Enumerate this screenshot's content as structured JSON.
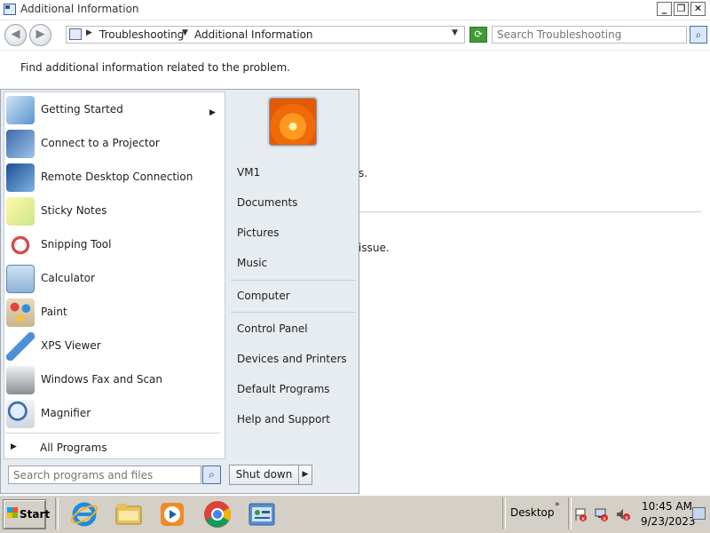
{
  "window": {
    "title": "Additional Information",
    "minimize": "_",
    "restore": "❐",
    "close": "✕"
  },
  "address_bar": {
    "breadcrumb": [
      "Troubleshooting",
      "Additional Information"
    ],
    "search_placeholder": "Search Troubleshooting"
  },
  "content": {
    "description": "Find additional information related to the problem.",
    "partial_line_1": "s.",
    "partial_line_2": "issue."
  },
  "start_menu": {
    "programs": [
      {
        "label": "Getting Started",
        "icon": "getting-started-icon",
        "has_submenu": true
      },
      {
        "label": "Connect to a Projector",
        "icon": "projector-icon"
      },
      {
        "label": "Remote Desktop Connection",
        "icon": "remote-desktop-icon"
      },
      {
        "label": "Sticky Notes",
        "icon": "sticky-notes-icon"
      },
      {
        "label": "Snipping Tool",
        "icon": "scissors-icon"
      },
      {
        "label": "Calculator",
        "icon": "calculator-icon"
      },
      {
        "label": "Paint",
        "icon": "paint-palette-icon"
      },
      {
        "label": "XPS Viewer",
        "icon": "paper-plane-icon"
      },
      {
        "label": "Windows Fax and Scan",
        "icon": "fax-icon"
      },
      {
        "label": "Magnifier",
        "icon": "magnifier-icon"
      }
    ],
    "all_programs": "All Programs",
    "search_placeholder": "Search programs and files",
    "right_links": {
      "user": "VM1",
      "documents": "Documents",
      "pictures": "Pictures",
      "music": "Music",
      "computer": "Computer",
      "control_panel": "Control Panel",
      "devices_printers": "Devices and Printers",
      "default_programs": "Default Programs",
      "help_support": "Help and Support"
    },
    "shutdown": "Shut down"
  },
  "taskbar": {
    "start": "Start",
    "pinned": [
      "internet-explorer-icon",
      "file-explorer-icon",
      "media-player-icon",
      "chrome-icon",
      "control-panel-icon"
    ],
    "toolbar_label": "Desktop",
    "time": "10:45 AM",
    "date": "9/23/2023"
  },
  "colors": {
    "start_menu_bg": "#e7ecf1",
    "taskbar_bg": "#d4d0c8",
    "accent_blue": "#2b5797"
  }
}
